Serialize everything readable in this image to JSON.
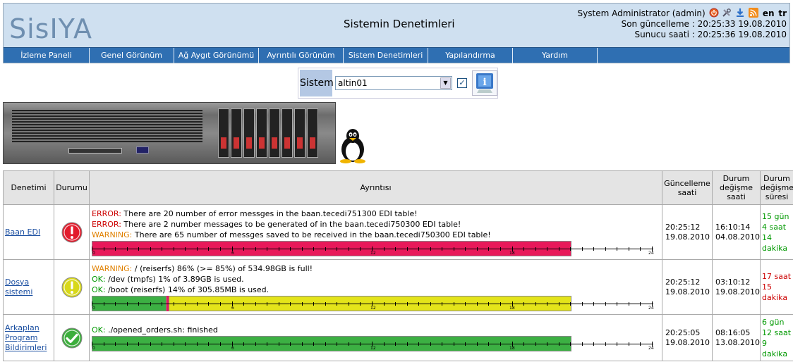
{
  "header": {
    "logo_text": "SisIYA",
    "title": "Sistemin Denetimleri",
    "user": "System Administrator (admin)",
    "langs": [
      "en",
      "tr"
    ],
    "last_update": "Son güncelleme : 20:25:33 19.08.2010",
    "server_time": "Sunucu saati : 20:25:36 19.08.2010",
    "icons": [
      "power-icon",
      "tools-icon",
      "download-icon",
      "rss-icon"
    ]
  },
  "nav": [
    "İzleme Paneli",
    "Genel Görünüm",
    "Ağ Aygıt Görünümü",
    "Ayrıntılı Görünüm",
    "Sistem Denetimleri",
    "Yapılandırma",
    "Yardım"
  ],
  "selector": {
    "label": "Sistem",
    "value": "altin01",
    "checked": true
  },
  "table": {
    "headers": [
      "Denetimi",
      "Durumu",
      "Ayrıntısı",
      "Güncelleme saati",
      "Durum değişme saati",
      "Durum değişme süresi"
    ],
    "axis_labels": [
      "0",
      "6",
      "12",
      "18",
      "24"
    ],
    "rows": [
      {
        "name_lines": [
          "Baan EDI"
        ],
        "status": "error",
        "lines": [
          {
            "level": "ERROR:",
            "text": " There are 20 number of error messges in the baan.tecedi751300 EDI table!"
          },
          {
            "level": "ERROR:",
            "text": " There are 2 number messages to be generated of in the baan.tecedi750300 EDI table!"
          },
          {
            "level": "WARNING:",
            "text": " There are 65 number of messges saved to be received in the baan.tecedi750300 EDI table!"
          }
        ],
        "timeline": [
          {
            "from": 0,
            "to": 20.5,
            "state": "error"
          }
        ],
        "update_time": [
          "20:25:12",
          "19.08.2010"
        ],
        "change_time": [
          "16:10:14",
          "04.08.2010"
        ],
        "duration": [
          "15 gün",
          "4 saat",
          "14",
          "dakika"
        ],
        "duration_color": "#009900"
      },
      {
        "name_lines": [
          "Dosya",
          "sistemi"
        ],
        "status": "warning",
        "lines": [
          {
            "level": "WARNING:",
            "text": " / (reiserfs) 86% (>= 85%) of 534.98GB is full!"
          },
          {
            "level": "OK:",
            "text": " /dev (tmpfs) 1% of 3.89GB is used."
          },
          {
            "level": "OK:",
            "text": " /boot (reiserfs) 14% of 305.85MB is used."
          }
        ],
        "timeline": [
          {
            "from": 0,
            "to": 3.2,
            "state": "ok"
          },
          {
            "from": 3.2,
            "to": 3.3,
            "state": "error"
          },
          {
            "from": 3.3,
            "to": 20.5,
            "state": "warning"
          }
        ],
        "update_time": [
          "20:25:12",
          "19.08.2010"
        ],
        "change_time": [
          "03:10:12",
          "19.08.2010"
        ],
        "duration": [
          "17 saat",
          "15",
          "dakika"
        ],
        "duration_color": "#cc0000"
      },
      {
        "name_lines": [
          "Arkaplan",
          "Program",
          "Bildirimleri"
        ],
        "status": "ok",
        "lines": [
          {
            "level": "OK:",
            "text": " ./opened_orders.sh: finished"
          }
        ],
        "timeline": [
          {
            "from": 0,
            "to": 20.5,
            "state": "ok"
          }
        ],
        "update_time": [
          "20:25:05",
          "19.08.2010"
        ],
        "change_time": [
          "08:16:05",
          "13.08.2010"
        ],
        "duration": [
          "6 gün",
          "12 saat",
          "9",
          "dakika"
        ],
        "duration_color": "#009900"
      }
    ]
  },
  "colors": {
    "error": "#e8195a",
    "warning": "#e4e41a",
    "ok": "#3cb043",
    "nav": "#2f6fb2"
  }
}
